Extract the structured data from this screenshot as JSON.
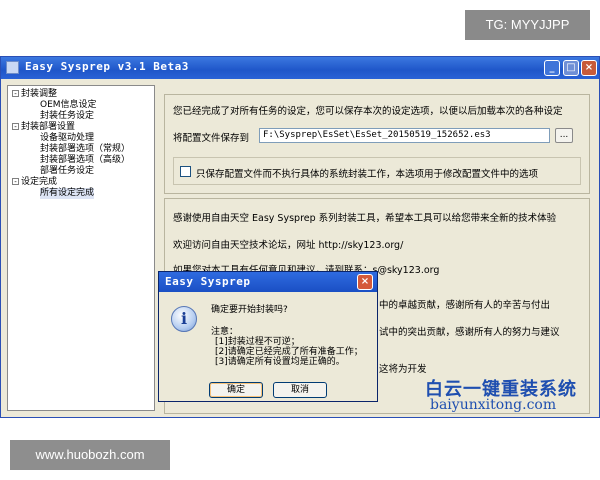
{
  "badges": {
    "telegram": "TG: MYYJJPP",
    "site": "www.huobozh.com"
  },
  "window": {
    "title": "Easy Sysprep v3.1 Beta3",
    "minimize": "_",
    "maximize": "□",
    "close": "×"
  },
  "tree": {
    "items": [
      {
        "label": "封装调整",
        "toggle": "-"
      },
      {
        "label": "OEM信息设定"
      },
      {
        "label": "封装任务设定"
      },
      {
        "label": "封装部署设置",
        "toggle": "-"
      },
      {
        "label": "设备驱动处理"
      },
      {
        "label": "封装部署选项（常规）"
      },
      {
        "label": "封装部署选项（高级）"
      },
      {
        "label": "部署任务设定"
      },
      {
        "label": "设定完成",
        "toggle": "-"
      },
      {
        "label": "所有设定完成"
      }
    ]
  },
  "top_panel": {
    "intro": "您已经完成了对所有任务的设定，您可以保存本次的设定选项，以便以后加载本次的各种设定",
    "save_label": "将配置文件保存到",
    "path_value": "F:\\Sysprep\\EsSet\\EsSet_20150519_152652.es3",
    "browse": "...",
    "checkbox_label": "只保存配置文件而不执行具体的系统封装工作，本选项用于修改配置文件中的选项"
  },
  "info_panel": {
    "thanks": "感谢使用自由天空 Easy Sysprep 系列封装工具，希望本工具可以给您带来全新的技术体验",
    "forum": "欢迎访问自由天空技术论坛，网址 http://sky123.org/",
    "contact": "如果您对本工具有任何意见和建议，请到联系：s@sky123.org",
    "line4": "中的卓越贡献，感谢所有人的辛苦与付出",
    "line5": "试中的突出贡献，感谢所有人的努力与建议",
    "line6": "这将为开发"
  },
  "dialog": {
    "title": "Easy Sysprep",
    "close": "×",
    "question": "确定要开始封装吗?",
    "note_label": "注意：",
    "notes": [
      "[1]封装过程不可逆；",
      "[2]请确定已经完成了所有准备工作；",
      "[3]请确定所有设置均是正确的。"
    ],
    "ok": "确定",
    "cancel": "取消",
    "icon": "i"
  },
  "watermark": {
    "line1": "白云一键重装系统",
    "line2": "baiyunxitong.com"
  }
}
